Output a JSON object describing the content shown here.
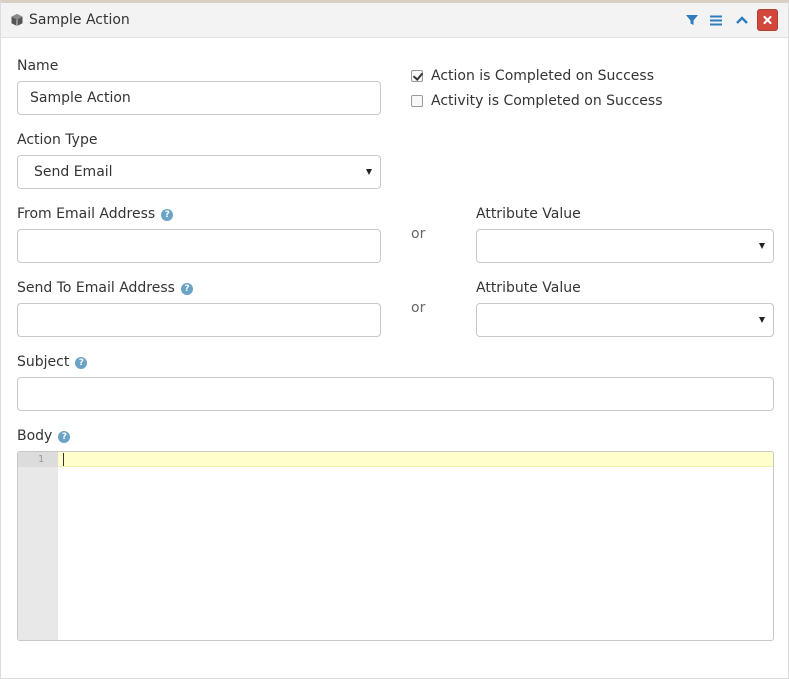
{
  "panel": {
    "title": "Sample Action"
  },
  "header_buttons": {
    "filter": "filter-icon",
    "menu": "menu-icon",
    "collapse": "chevron-up-icon",
    "close": "close-icon"
  },
  "form": {
    "name_label": "Name",
    "name_value": "Sample Action",
    "action_completed_label": "Action is Completed on Success",
    "action_completed_checked": true,
    "activity_completed_label": "Activity is Completed on Success",
    "activity_completed_checked": false,
    "action_type_label": "Action Type",
    "action_type_value": "Send Email",
    "from_label": "From Email Address",
    "from_value": "",
    "from_or": "or",
    "from_attr_label": "Attribute Value",
    "from_attr_value": "",
    "to_label": "Send To Email Address",
    "to_value": "",
    "to_or": "or",
    "to_attr_label": "Attribute Value",
    "to_attr_value": "",
    "subject_label": "Subject",
    "subject_value": "",
    "body_label": "Body",
    "body_line_number": "1",
    "help_glyph": "?"
  },
  "colors": {
    "close_button": "#d2473c",
    "header_icon": "#2f7bbf",
    "help_icon": "#6aa3c4",
    "active_line": "#ffffcc"
  }
}
